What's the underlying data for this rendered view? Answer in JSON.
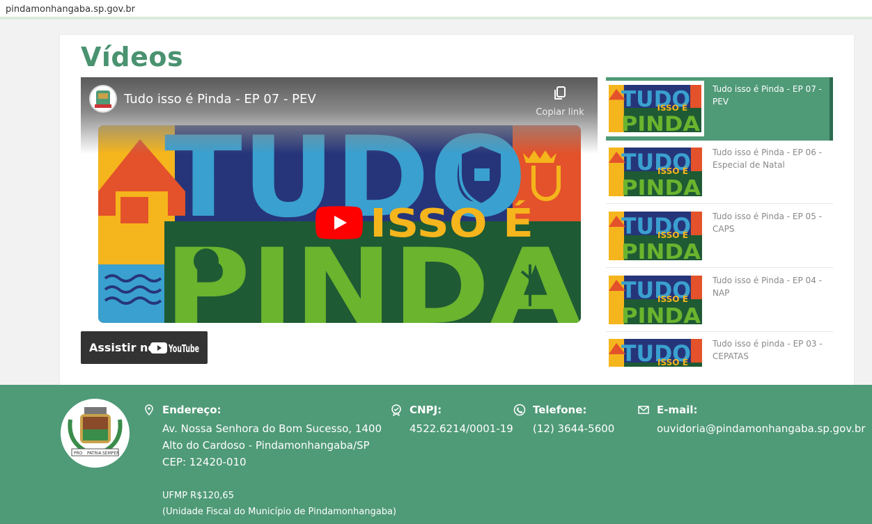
{
  "browser": {
    "url": "pindamonhangaba.sp.gov.br"
  },
  "section": {
    "title": "Vídeos"
  },
  "player": {
    "video_title": "Tudo isso é Pinda - EP 07 - PEV",
    "copy_link_label": "Copiar link",
    "watch_on_label": "Assistir no",
    "platform_logo": "YouTube",
    "thumbnail_words": [
      "TUDO",
      "ISSO É",
      "PINDA"
    ]
  },
  "playlist": {
    "items": [
      {
        "title": "Tudo isso é Pinda - EP 07 - PEV",
        "active": true
      },
      {
        "title": "Tudo isso é Pinda - EP 06 - Especial de Natal",
        "active": false
      },
      {
        "title": "Tudo isso é Pinda - EP 05 - CAPS",
        "active": false
      },
      {
        "title": "Tudo isso é Pinda - EP 04 - NAP",
        "active": false
      },
      {
        "title": "Tudo isso é pinda - EP 03 - CEPATAS",
        "active": false
      }
    ],
    "thumbnail_words": [
      "TUDO",
      "ISSO É",
      "PINDA"
    ]
  },
  "footer": {
    "address": {
      "label": "Endereço:",
      "lines": [
        "Av. Nossa Senhora do Bom Sucesso, 1400",
        "Alto do Cardoso - Pindamonhangaba/SP",
        "CEP: 12420-010"
      ]
    },
    "cnpj": {
      "label": "CNPJ:",
      "value": "4522.6214/0001-19"
    },
    "phone": {
      "label": "Telefone:",
      "value": "(12) 3644-5600"
    },
    "email": {
      "label": "E-mail:",
      "value": "ouvidoria@pindamonhangaba.sp.gov.br"
    },
    "ufmp": {
      "value": "UFMP R$120,65",
      "description": "(Unidade Fiscal do Município de Pindamonhangaba)"
    },
    "crest_words": [
      "PRO",
      "PATRIA",
      "SEMPER"
    ]
  },
  "colors": {
    "brand_green": "#4f9a77",
    "title_green": "#4a9270",
    "youtube_red": "#ff0000"
  }
}
